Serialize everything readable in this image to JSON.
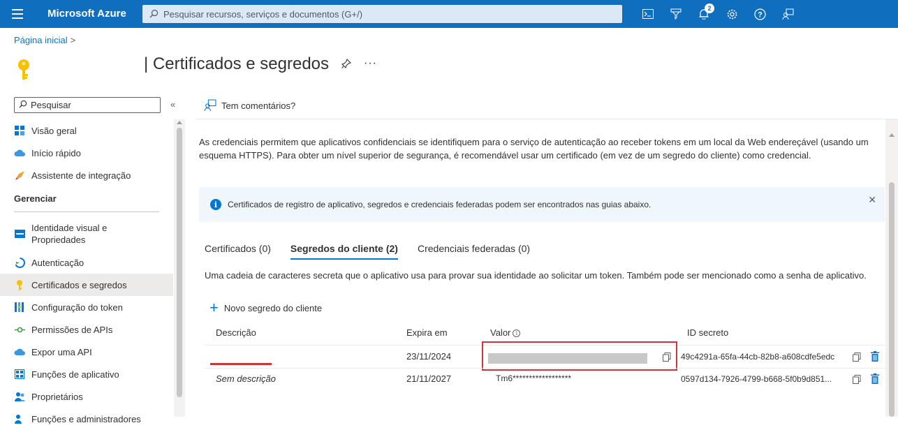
{
  "topbar": {
    "brand": "Microsoft Azure",
    "search_placeholder": "Pesquisar recursos, serviços e documentos (G+/)",
    "notification_count": "2"
  },
  "breadcrumb": {
    "home": "Página inicial",
    "separator": ">"
  },
  "header": {
    "title": "| Certificados e segredos",
    "more": "···"
  },
  "sidebar": {
    "search_placeholder": "Pesquisar",
    "collapse": "«",
    "items_top": [
      {
        "label": "Visão geral"
      },
      {
        "label": "Início rápido"
      },
      {
        "label": "Assistente de integração"
      }
    ],
    "section_manage": "Gerenciar",
    "items_manage": [
      {
        "label": "Identidade visual e Propriedades"
      },
      {
        "label": "Autenticação"
      },
      {
        "label": "Certificados e segredos"
      },
      {
        "label": "Configuração do token"
      },
      {
        "label": "Permissões de APIs"
      },
      {
        "label": "Expor uma API"
      },
      {
        "label": "Funções de aplicativo"
      },
      {
        "label": "Proprietários"
      },
      {
        "label": "Funções e administradores"
      }
    ]
  },
  "main": {
    "feedback": "Tem comentários?",
    "intro": "As credenciais permitem que aplicativos confidenciais se identifiquem para o serviço de autenticação ao receber tokens em um local da Web endereçável (usando um esquema HTTPS). Para obter um nível superior de segurança, é recomendável usar um certificado (em vez de um segredo do cliente) como credencial.",
    "info_banner": "Certificados de registro de aplicativo, segredos e credenciais federadas podem ser encontrados nas guias abaixo.",
    "tabs": [
      {
        "label": "Certificados (0)"
      },
      {
        "label": "Segredos do cliente (2)"
      },
      {
        "label": "Credenciais federadas (0)"
      }
    ],
    "tab_description": "Uma cadeia de caracteres secreta que o aplicativo usa para provar sua identidade ao solicitar um token. Também pode ser mencionado como a senha de aplicativo.",
    "new_secret": "Novo segredo do cliente",
    "table": {
      "headers": [
        "Descrição",
        "Expira em",
        "Valor",
        "ID secreto"
      ],
      "rows": [
        {
          "description": "",
          "expires": "23/11/2024",
          "value": "",
          "secret_id": "49c4291a-65fa-44cb-82b8-a608cdfe5edc"
        },
        {
          "description": "Sem descrição",
          "expires": "21/11/2027",
          "value": "Tm6******************",
          "secret_id": "0597d134-7926-4799-b668-5f0b9d851..."
        }
      ]
    }
  },
  "colors": {
    "brand_blue": "#106ebe",
    "accent": "#0078d4",
    "highlight_red": "#d13438"
  }
}
